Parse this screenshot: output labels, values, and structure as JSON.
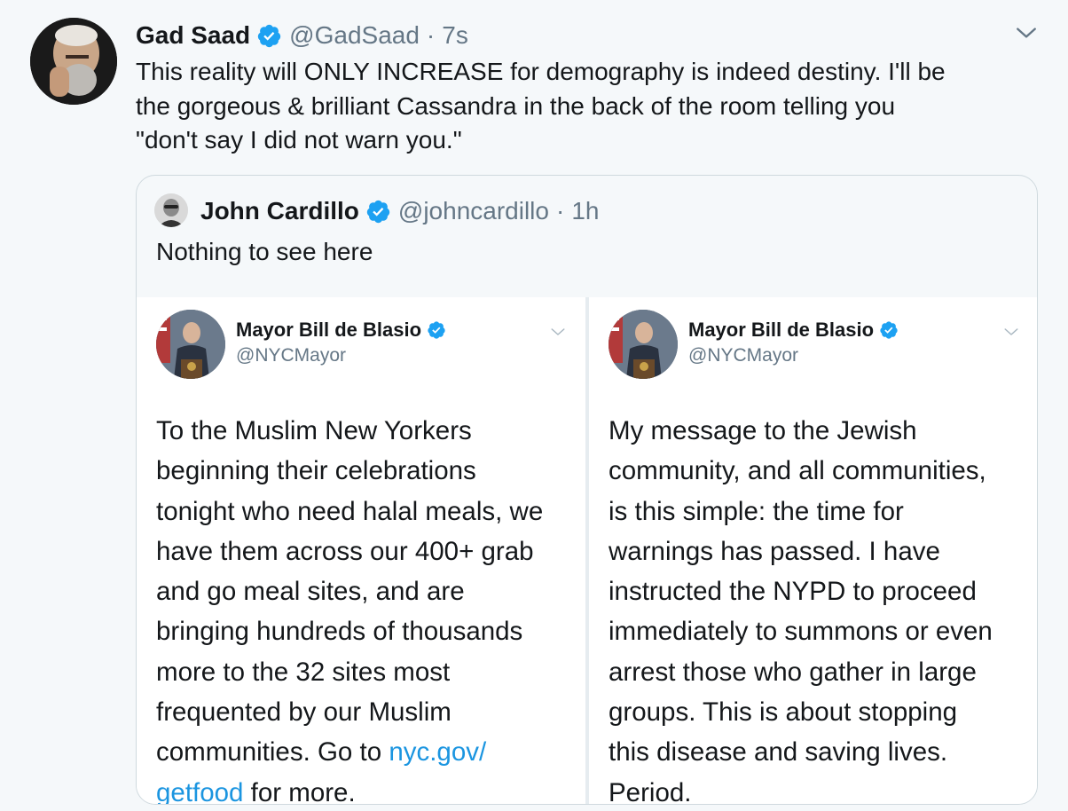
{
  "tweet": {
    "author_name": "Gad Saad",
    "author_handle": "@GadSaad",
    "separator": "·",
    "time": "7s",
    "text_lines": [
      "This reality will ONLY INCREASE for demography is indeed destiny.  I'll be",
      "the gorgeous & brilliant Cassandra in the back of the room telling you",
      "\"don't say I did not warn you.\""
    ]
  },
  "quote": {
    "author_name": "John Cardillo",
    "author_handle": "@johncardillo",
    "separator": "·",
    "time": "1h",
    "text": "Nothing to see here"
  },
  "cards": [
    {
      "name": "Mayor Bill de Blasio",
      "handle": "@NYCMayor",
      "lines": [
        {
          "text": "To the Muslim New Yorkers"
        },
        {
          "text": "beginning their celebrations"
        },
        {
          "text": "tonight who need halal meals, we"
        },
        {
          "text": "have them across our 400+ grab"
        },
        {
          "text": "and go meal sites, and are"
        },
        {
          "text": "bringing hundreds of thousands"
        },
        {
          "text": "more to the 32 sites most"
        },
        {
          "text": "frequented by our Muslim"
        },
        {
          "text": "communities. Go to ",
          "link": "nyc.gov/"
        },
        {
          "text": "",
          "link": "getfood",
          "after": " for more."
        }
      ]
    },
    {
      "name": "Mayor Bill de Blasio",
      "handle": "@NYCMayor",
      "lines": [
        {
          "text": "My message to the Jewish"
        },
        {
          "text": "community, and all communities,"
        },
        {
          "text": "is this simple: the time for"
        },
        {
          "text": "warnings has passed. I have"
        },
        {
          "text": "instructed the NYPD to proceed"
        },
        {
          "text": "immediately to summons or even"
        },
        {
          "text": "arrest those who gather in large"
        },
        {
          "text": "groups. This is about stopping"
        },
        {
          "text": "this disease and saving lives."
        },
        {
          "text": "Period."
        }
      ]
    }
  ],
  "colors": {
    "background": "#f5f8fa",
    "text": "#14171a",
    "secondary": "#657786",
    "link": "#1b95e0",
    "verified": "#1da1f2"
  },
  "icons": {
    "verified": "verified-badge-icon",
    "caret": "chevron-down-icon"
  }
}
